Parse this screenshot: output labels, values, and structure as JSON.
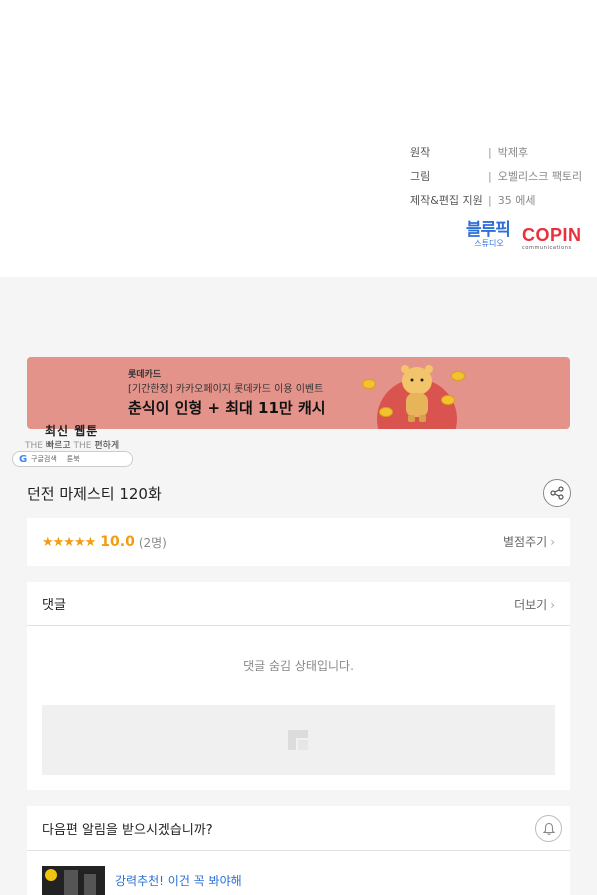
{
  "credits": [
    {
      "key": "원작",
      "value": "박제후"
    },
    {
      "key": "그림",
      "value": "오벨리스크 팩토리"
    },
    {
      "key": "제작&편집 지원",
      "value": "35 에세"
    }
  ],
  "credit_separator": "|",
  "logos": {
    "blue_main": "블루픽",
    "blue_sub": "스튜디오",
    "copin_main": "COPIN",
    "copin_sub": "communications"
  },
  "banner": {
    "brand": "롯데카드",
    "subtitle": "[기간한정] 카카오페이지 롯데카드 이용 이벤트",
    "headline": "춘식이 인형 + 최대 11만 캐시",
    "bg_color": "#e4938a"
  },
  "badge": {
    "title": "최신 웹툰",
    "line_the1": "THE",
    "line_fast": "빠르고",
    "line_the2": "THE",
    "line_easy": "편하게",
    "google": "구글검색",
    "toonbook": "툰북"
  },
  "episode": {
    "title": "던전 마제스티 120화"
  },
  "rating": {
    "stars": "★★★★★",
    "score": "10.0",
    "count": "(2명)",
    "rate_link": "별점주기",
    "accent": "#f39c12"
  },
  "comments": {
    "title": "댓글",
    "more": "더보기",
    "hidden_message": "댓글 숨김 상태입니다."
  },
  "notify": {
    "question": "다음편 알림을 받으시겠습니까?",
    "recommend": "강력추천! 이건 꼭 봐야해",
    "link_color": "#2a6fd6"
  },
  "icons": {
    "share": "share-icon",
    "bell": "bell-icon",
    "chevron": "chevron-right-icon",
    "image_placeholder": "image-placeholder-icon"
  }
}
